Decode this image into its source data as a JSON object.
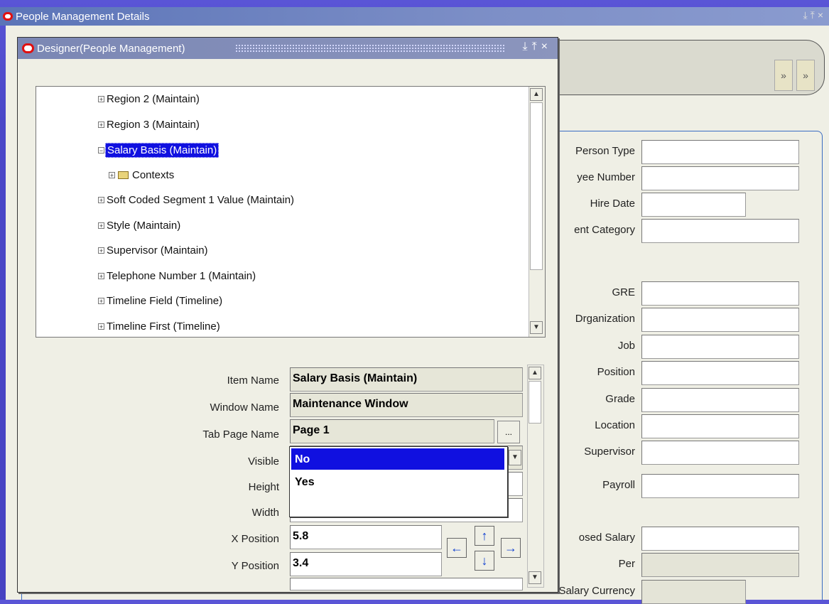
{
  "outer_window": {
    "title": "People Management Details",
    "controls": "⤓⤒×",
    "tab_buttons": [
      "»",
      "»"
    ]
  },
  "right_fields": [
    {
      "label": "Person Type",
      "kind": "wide"
    },
    {
      "label": "yee Number",
      "kind": "wide"
    },
    {
      "label": "Hire Date",
      "kind": "short"
    },
    {
      "label": "ent Category",
      "kind": "wide"
    },
    {
      "label": "GRE",
      "kind": "wide"
    },
    {
      "label": "Drganization",
      "kind": "wide"
    },
    {
      "label": "Job",
      "kind": "wide"
    },
    {
      "label": "Position",
      "kind": "wide"
    },
    {
      "label": "Grade",
      "kind": "wide"
    },
    {
      "label": "Location",
      "kind": "wide"
    },
    {
      "label": "Supervisor",
      "kind": "wide"
    },
    {
      "label": "Payroll",
      "kind": "wide"
    },
    {
      "label": "osed Salary",
      "kind": "wide"
    },
    {
      "label": "Per",
      "kind": "ro"
    },
    {
      "label": "Salary Currency",
      "kind": "ro-short"
    }
  ],
  "designer": {
    "title": "Designer(People Management)",
    "controls": "⤓⤒×",
    "tree": [
      {
        "label": "Region 2 (Maintain)",
        "indent": 0,
        "selected": false
      },
      {
        "label": "Region 3 (Maintain)",
        "indent": 0,
        "selected": false
      },
      {
        "label": "Salary Basis (Maintain)",
        "indent": 0,
        "selected": true
      },
      {
        "label": "Contexts",
        "indent": 1,
        "selected": false,
        "folder": true
      },
      {
        "label": "Soft Coded Segment 1 Value (Maintain)",
        "indent": 0,
        "selected": false
      },
      {
        "label": "Style (Maintain)",
        "indent": 0,
        "selected": false
      },
      {
        "label": "Supervisor (Maintain)",
        "indent": 0,
        "selected": false
      },
      {
        "label": "Telephone Number 1 (Maintain)",
        "indent": 0,
        "selected": false
      },
      {
        "label": "Timeline Field (Timeline)",
        "indent": 0,
        "selected": false
      },
      {
        "label": "Timeline First (Timeline)",
        "indent": 0,
        "selected": false
      }
    ],
    "props": {
      "item_name_label": "Item Name",
      "item_name_value": "Salary Basis (Maintain)",
      "window_name_label": "Window Name",
      "window_name_value": "Maintenance Window",
      "tab_page_label": "Tab Page Name",
      "tab_page_value": "Page 1",
      "tab_page_lov": "...",
      "visible_label": "Visible",
      "height_label": "Height",
      "width_label": "Width",
      "x_label": "X Position",
      "x_value": "5.8",
      "y_label": "Y Position",
      "y_value": "3.4"
    },
    "visible_options": [
      "No",
      "Yes"
    ],
    "visible_selected": "No",
    "arrows": {
      "up": "↑",
      "down": "↓",
      "left": "←",
      "right": "→"
    }
  }
}
